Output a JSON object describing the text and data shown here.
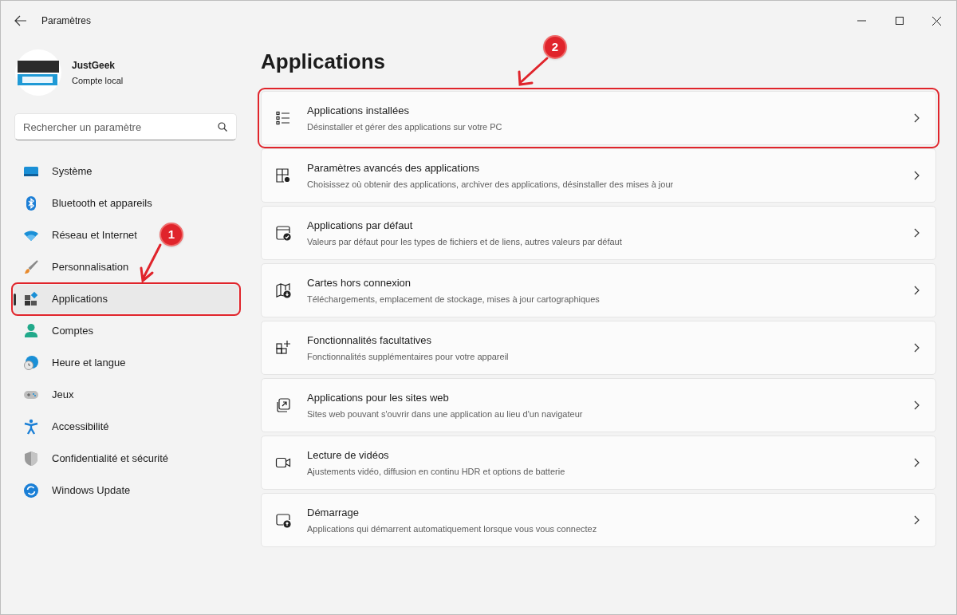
{
  "window": {
    "title": "Paramètres"
  },
  "account": {
    "name": "JustGeek",
    "type": "Compte local"
  },
  "search": {
    "placeholder": "Rechercher un paramètre"
  },
  "sidebar": {
    "items": [
      {
        "kind": "system",
        "label": "Système",
        "selected": false
      },
      {
        "kind": "bluetooth",
        "label": "Bluetooth et appareils",
        "selected": false
      },
      {
        "kind": "network",
        "label": "Réseau et Internet",
        "selected": false
      },
      {
        "kind": "brush",
        "label": "Personnalisation",
        "selected": false
      },
      {
        "kind": "apps",
        "label": "Applications",
        "selected": true,
        "callout": "1"
      },
      {
        "kind": "accounts",
        "label": "Comptes",
        "selected": false
      },
      {
        "kind": "time",
        "label": "Heure et langue",
        "selected": false
      },
      {
        "kind": "games",
        "label": "Jeux",
        "selected": false
      },
      {
        "kind": "accessibility",
        "label": "Accessibilité",
        "selected": false
      },
      {
        "kind": "privacy",
        "label": "Confidentialité et sécurité",
        "selected": false
      },
      {
        "kind": "update",
        "label": "Windows Update",
        "selected": false
      }
    ]
  },
  "page": {
    "title": "Applications"
  },
  "cards": [
    {
      "kind": "list",
      "title": "Applications installées",
      "description": "Désinstaller et gérer des applications sur votre PC",
      "callout": "2"
    },
    {
      "kind": "advanced",
      "title": "Paramètres avancés des applications",
      "description": "Choisissez où obtenir des applications, archiver des applications, désinstaller des mises à jour"
    },
    {
      "kind": "default",
      "title": "Applications par défaut",
      "description": "Valeurs par défaut pour les types de fichiers et de liens, autres valeurs par défaut"
    },
    {
      "kind": "map",
      "title": "Cartes hors connexion",
      "description": "Téléchargements, emplacement de stockage, mises à jour cartographiques"
    },
    {
      "kind": "optional",
      "title": "Fonctionnalités facultatives",
      "description": "Fonctionnalités supplémentaires pour votre appareil"
    },
    {
      "kind": "web",
      "title": "Applications pour les sites web",
      "description": "Sites web pouvant s'ouvrir dans une application au lieu d'un navigateur"
    },
    {
      "kind": "video",
      "title": "Lecture de vidéos",
      "description": "Ajustements vidéo, diffusion en continu HDR et options de batterie"
    },
    {
      "kind": "startup",
      "title": "Démarrage",
      "description": "Applications qui démarrent automatiquement lorsque vous vous connectez"
    }
  ]
}
